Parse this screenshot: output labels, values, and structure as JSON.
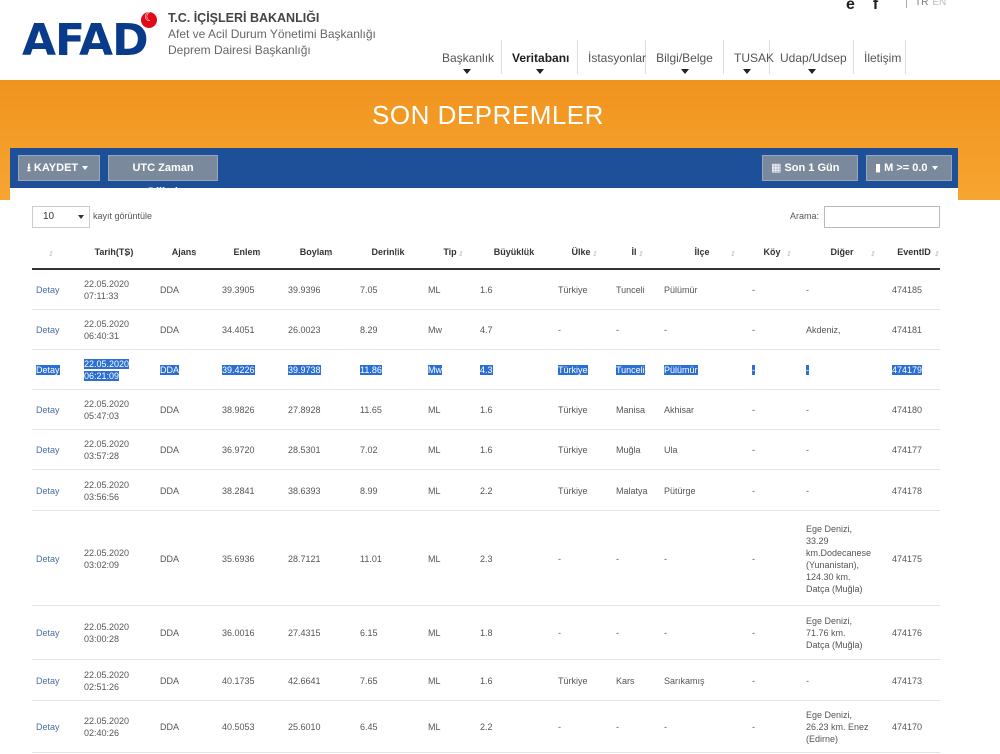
{
  "header": {
    "logo": "AFAD",
    "org_title": "T.C. İÇİŞLERİ BAKANLIĞI",
    "org_line1": "Afet ve Acil Durum Yönetimi Başkanlığı",
    "org_line2": "Deprem Dairesi Başkanlığı",
    "social_icons": [
      "twitter-icon",
      "facebook-icon"
    ],
    "lang_tr": "TR",
    "lang_en": "EN"
  },
  "nav": [
    {
      "label": "Başkanlık",
      "caret": true,
      "active": false
    },
    {
      "label": "Veritabanı",
      "caret": true,
      "active": true
    },
    {
      "label": "İstasyonlar",
      "caret": false,
      "active": false
    },
    {
      "label": "Bilgi/Belge",
      "caret": true,
      "active": false
    },
    {
      "label": "TUSAK",
      "caret": true,
      "active": false
    },
    {
      "label": "Udap/Udsep",
      "caret": true,
      "active": false
    },
    {
      "label": "İletişim",
      "caret": false,
      "active": false
    }
  ],
  "banner": {
    "title": "SON DEPREMLER"
  },
  "toolbar": {
    "save": "KAYDET",
    "utc": "UTC Zaman Dilimi",
    "day": "Son 1 Gün",
    "mag": "M >= 0.0"
  },
  "controls": {
    "length_value": "10",
    "length_label": "kayıt görüntüle",
    "search_label": "Arama:"
  },
  "table": {
    "columns": [
      "",
      "Tarih(TS)",
      "Ajans",
      "Enlem",
      "Boylam",
      "Derinlik",
      "Tip",
      "Büyüklük",
      "Ülke",
      "İl",
      "İlçe",
      "Köy",
      "Diğer",
      "EventID"
    ],
    "rows": [
      {
        "detay": "Detay",
        "date": "22.05.2020",
        "time": "07:11:33",
        "agency": "DDA",
        "lat": "39.3905",
        "lon": "39.9396",
        "depth": "7.05",
        "type": "ML",
        "mag": "1.6",
        "country": "Türkiye",
        "province": "Tunceli",
        "district": "Pülümür",
        "village": "-",
        "other": [
          "-"
        ],
        "event": "474185"
      },
      {
        "detay": "Detay",
        "date": "22.05.2020",
        "time": "06:40:31",
        "agency": "DDA",
        "lat": "34.4051",
        "lon": "26.0023",
        "depth": "8.29",
        "type": "Mw",
        "mag": "4.7",
        "country": "-",
        "province": "-",
        "district": "-",
        "village": "-",
        "other": [
          "Akdeniz,"
        ],
        "event": "474181"
      },
      {
        "detay": "Detay",
        "date": "22.05.2020",
        "time": "06:21:09",
        "agency": "DDA",
        "lat": "39.4226",
        "lon": "39.9738",
        "depth": "11.86",
        "type": "Mw",
        "mag": "4.3",
        "country": "Türkiye",
        "province": "Tunceli",
        "district": "Pülümür",
        "village": "-",
        "other": [
          "-"
        ],
        "event": "474179",
        "selected": true
      },
      {
        "detay": "Detay",
        "date": "22.05.2020",
        "time": "05:47:03",
        "agency": "DDA",
        "lat": "38.9826",
        "lon": "27.8928",
        "depth": "11.65",
        "type": "ML",
        "mag": "1.6",
        "country": "Türkiye",
        "province": "Manisa",
        "district": "Akhisar",
        "village": "-",
        "other": [
          "-"
        ],
        "event": "474180"
      },
      {
        "detay": "Detay",
        "date": "22.05.2020",
        "time": "03:57:28",
        "agency": "DDA",
        "lat": "36.9720",
        "lon": "28.5301",
        "depth": "7.02",
        "type": "ML",
        "mag": "1.6",
        "country": "Türkiye",
        "province": "Muğla",
        "district": "Ula",
        "village": "-",
        "other": [
          "-"
        ],
        "event": "474177"
      },
      {
        "detay": "Detay",
        "date": "22.05.2020",
        "time": "03:56:56",
        "agency": "DDA",
        "lat": "38.2841",
        "lon": "38.6393",
        "depth": "8.99",
        "type": "ML",
        "mag": "2.2",
        "country": "Türkiye",
        "province": "Malatya",
        "district": "Pütürge",
        "village": "-",
        "other": [
          "-"
        ],
        "event": "474178"
      },
      {
        "detay": "Detay",
        "date": "22.05.2020",
        "time": "03:02:09",
        "agency": "DDA",
        "lat": "35.6936",
        "lon": "28.7121",
        "depth": "11.01",
        "type": "ML",
        "mag": "2.3",
        "country": "-",
        "province": "-",
        "district": "-",
        "village": "-",
        "other": [
          "Ege Denizi,",
          "33.29",
          "km.Dodecanese",
          "(Yunanistan),",
          "124.30 km.",
          "Datça (Muğla)"
        ],
        "event": "474175"
      },
      {
        "detay": "Detay",
        "date": "22.05.2020",
        "time": "03:00:28",
        "agency": "DDA",
        "lat": "36.0016",
        "lon": "27.4315",
        "depth": "6.15",
        "type": "ML",
        "mag": "1.8",
        "country": "-",
        "province": "-",
        "district": "-",
        "village": "-",
        "other": [
          "Ege Denizi,",
          "71.76 km.",
          "Datça (Muğla)"
        ],
        "event": "474176"
      },
      {
        "detay": "Detay",
        "date": "22.05.2020",
        "time": "02:51:26",
        "agency": "DDA",
        "lat": "40.1735",
        "lon": "42.6641",
        "depth": "7.65",
        "type": "ML",
        "mag": "1.6",
        "country": "Türkiye",
        "province": "Kars",
        "district": "Sarıkamış",
        "village": "-",
        "other": [
          "-"
        ],
        "event": "474173"
      },
      {
        "detay": "Detay",
        "date": "22.05.2020",
        "time": "02:40:26",
        "agency": "DDA",
        "lat": "40.5053",
        "lon": "25.6010",
        "depth": "6.45",
        "type": "ML",
        "mag": "2.2",
        "country": "-",
        "province": "-",
        "district": "-",
        "village": "-",
        "other": [
          "Ege Denizi,",
          "26.23 km. Enez",
          "(Edirne)"
        ],
        "event": "474170"
      }
    ]
  }
}
